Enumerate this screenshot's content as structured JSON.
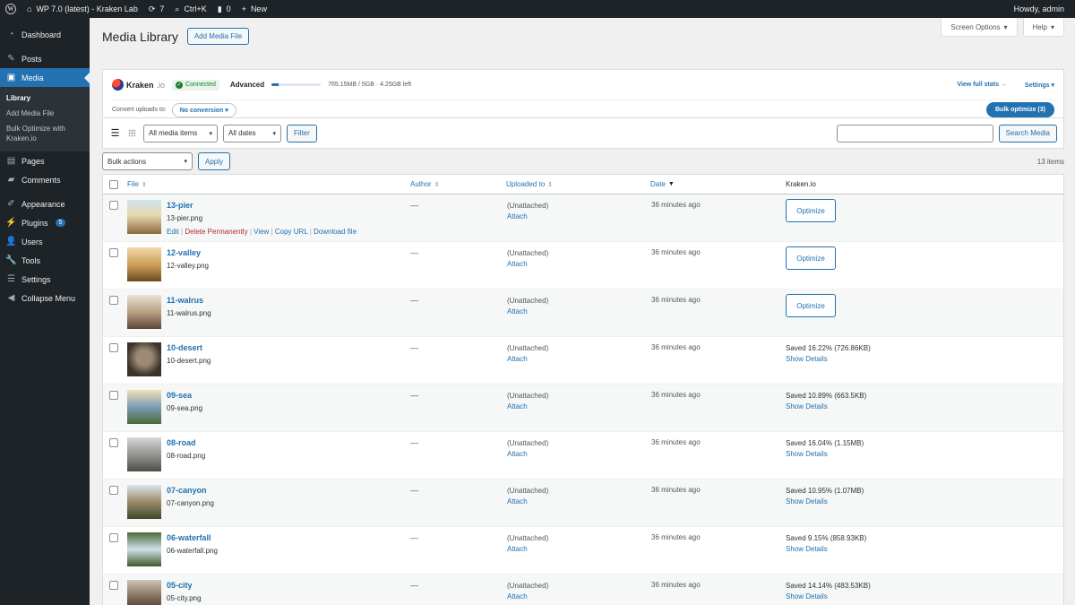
{
  "adminbar": {
    "site_name": "WP 7.0 (latest) - Kraken Lab",
    "updates_count": "7",
    "search_shortcut": "Ctrl+K",
    "comments_count": "0",
    "new_label": "New",
    "greeting": "Howdy, admin"
  },
  "sidebar": {
    "items": [
      {
        "label": "Dashboard",
        "icon": "dashboard-icon"
      },
      {
        "label": "Posts",
        "icon": "pin-icon"
      },
      {
        "label": "Media",
        "icon": "media-icon"
      },
      {
        "label": "Pages",
        "icon": "page-icon"
      },
      {
        "label": "Comments",
        "icon": "comment-icon"
      },
      {
        "label": "Appearance",
        "icon": "brush-icon"
      },
      {
        "label": "Plugins",
        "icon": "plugin-icon",
        "badge": "5"
      },
      {
        "label": "Users",
        "icon": "user-icon"
      },
      {
        "label": "Tools",
        "icon": "wrench-icon"
      },
      {
        "label": "Settings",
        "icon": "sliders-icon"
      },
      {
        "label": "Collapse Menu",
        "icon": "collapse-icon"
      }
    ],
    "submenu": [
      "Library",
      "Add Media File",
      "Bulk Optimize with Kraken.io"
    ]
  },
  "header": {
    "title": "Media Library",
    "add_button": "Add Media File",
    "screen_options": "Screen Options",
    "help": "Help"
  },
  "kraken": {
    "brand": "Kraken",
    "brand_suffix": ".io",
    "status": "Connected",
    "plan": "Advanced",
    "quota_fraction": 0.15,
    "quota_text": "765.15MB / 5GB · 4.25GB left",
    "view_stats": "View full stats →",
    "settings": "Settings",
    "convert_label": "Convert uploads to:",
    "convert_value": "No conversion",
    "bulk_optimize": "Bulk optimize (3)"
  },
  "filters": {
    "media_type": "All media items",
    "dates": "All dates",
    "filter_button": "Filter",
    "search_value": "",
    "search_button": "Search Media",
    "bulk_actions": "Bulk actions",
    "apply": "Apply",
    "items_count": "13 items"
  },
  "table": {
    "columns": {
      "file": "File",
      "author": "Author",
      "uploaded": "Uploaded to",
      "date": "Date",
      "kraken": "Kraken.io"
    },
    "row_actions": {
      "edit": "Edit",
      "delete": "Delete Permanently",
      "view": "View",
      "copy": "Copy URL",
      "download": "Download file"
    },
    "rows": [
      {
        "title": "13-pier",
        "file": "13-pier.png",
        "author": "—",
        "uploaded": "(Unattached)",
        "attach": "Attach",
        "date": "36 minutes ago",
        "kraken_action": "Optimize",
        "saved": "",
        "details": ""
      },
      {
        "title": "12-valley",
        "file": "12-valley.png",
        "author": "—",
        "uploaded": "(Unattached)",
        "attach": "Attach",
        "date": "36 minutes ago",
        "kraken_action": "Optimize",
        "saved": "",
        "details": ""
      },
      {
        "title": "11-walrus",
        "file": "11-walrus.png",
        "author": "—",
        "uploaded": "(Unattached)",
        "attach": "Attach",
        "date": "36 minutes ago",
        "kraken_action": "Optimize",
        "saved": "",
        "details": ""
      },
      {
        "title": "10-desert",
        "file": "10-desert.png",
        "author": "—",
        "uploaded": "(Unattached)",
        "attach": "Attach",
        "date": "36 minutes ago",
        "kraken_action": "",
        "saved": "Saved 16.22% (726.86KB)",
        "details": "Show Details"
      },
      {
        "title": "09-sea",
        "file": "09-sea.png",
        "author": "—",
        "uploaded": "(Unattached)",
        "attach": "Attach",
        "date": "36 minutes ago",
        "kraken_action": "",
        "saved": "Saved 10.89% (663.5KB)",
        "details": "Show Details"
      },
      {
        "title": "08-road",
        "file": "08-road.png",
        "author": "—",
        "uploaded": "(Unattached)",
        "attach": "Attach",
        "date": "36 minutes ago",
        "kraken_action": "",
        "saved": "Saved 16.04% (1.15MB)",
        "details": "Show Details"
      },
      {
        "title": "07-canyon",
        "file": "07-canyon.png",
        "author": "—",
        "uploaded": "(Unattached)",
        "attach": "Attach",
        "date": "36 minutes ago",
        "kraken_action": "",
        "saved": "Saved 10.95% (1.07MB)",
        "details": "Show Details"
      },
      {
        "title": "06-waterfall",
        "file": "06-waterfall.png",
        "author": "—",
        "uploaded": "(Unattached)",
        "attach": "Attach",
        "date": "36 minutes ago",
        "kraken_action": "",
        "saved": "Saved 9.15% (858.93KB)",
        "details": "Show Details"
      },
      {
        "title": "05-city",
        "file": "05-city.png",
        "author": "—",
        "uploaded": "(Unattached)",
        "attach": "Attach",
        "date": "36 minutes ago",
        "kraken_action": "",
        "saved": "Saved 14.14% (483.53KB)",
        "details": "Show Details"
      }
    ]
  }
}
